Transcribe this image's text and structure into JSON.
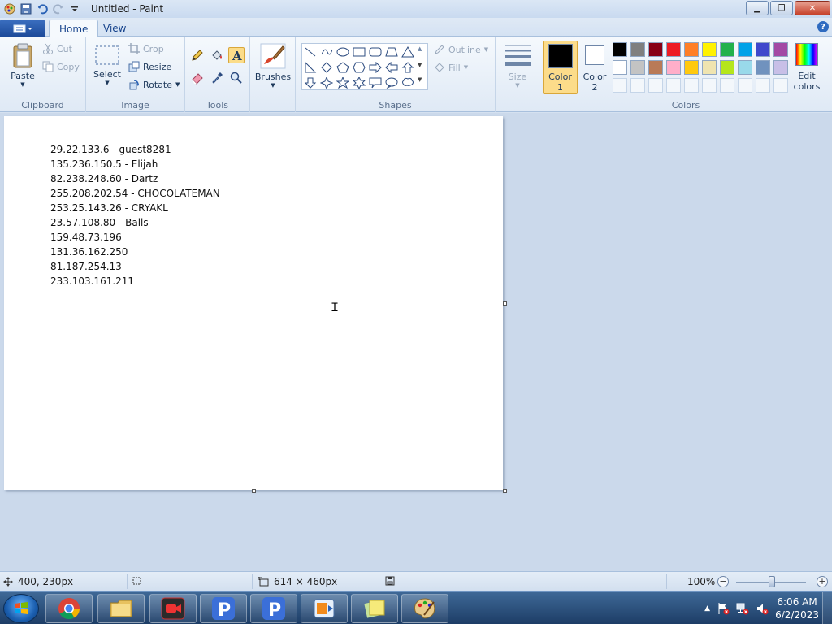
{
  "window": {
    "title": "Untitled - Paint"
  },
  "tabs": [
    {
      "label": "Home"
    },
    {
      "label": "View"
    }
  ],
  "ribbon": {
    "clipboard": {
      "label": "Clipboard",
      "paste": "Paste",
      "cut": "Cut",
      "copy": "Copy"
    },
    "image": {
      "label": "Image",
      "select": "Select",
      "crop": "Crop",
      "resize": "Resize",
      "rotate": "Rotate"
    },
    "tools": {
      "label": "Tools"
    },
    "brushes": {
      "label": "Brushes"
    },
    "shapes": {
      "label": "Shapes",
      "outline": "Outline",
      "fill": "Fill"
    },
    "size": {
      "label": "Size"
    },
    "colors": {
      "label": "Colors",
      "color1_line1": "Color",
      "color1_line2": "1",
      "color2_line1": "Color",
      "color2_line2": "2",
      "edit_line1": "Edit",
      "edit_line2": "colors",
      "row1": [
        "#000000",
        "#7f7f7f",
        "#880015",
        "#ed1c24",
        "#ff7f27",
        "#fff200",
        "#22b14c",
        "#00a2e8",
        "#3f48cc",
        "#a349a4"
      ],
      "row2": [
        "#ffffff",
        "#c3c3c3",
        "#b97a57",
        "#ffaec9",
        "#ffc90e",
        "#efe4b0",
        "#b5e61d",
        "#99d9ea",
        "#7092be",
        "#c8bfe7"
      ]
    }
  },
  "canvas": {
    "lines": [
      "29.22.133.6 - guest8281",
      "135.236.150.5 - Elijah",
      "82.238.248.60 - Dartz",
      "255.208.202.54 - CHOCOLATEMAN",
      "253.25.143.26 - CRYAKL",
      "23.57.108.80 - Balls",
      "159.48.73.196",
      "131.36.162.250",
      "81.187.254.13",
      "233.103.161.211"
    ]
  },
  "status": {
    "cursor_pos": "400, 230px",
    "canvas_size": "614 × 460px",
    "zoom": "100%"
  },
  "taskbar": {
    "time": "6:06 AM",
    "date": "6/2/2023"
  }
}
